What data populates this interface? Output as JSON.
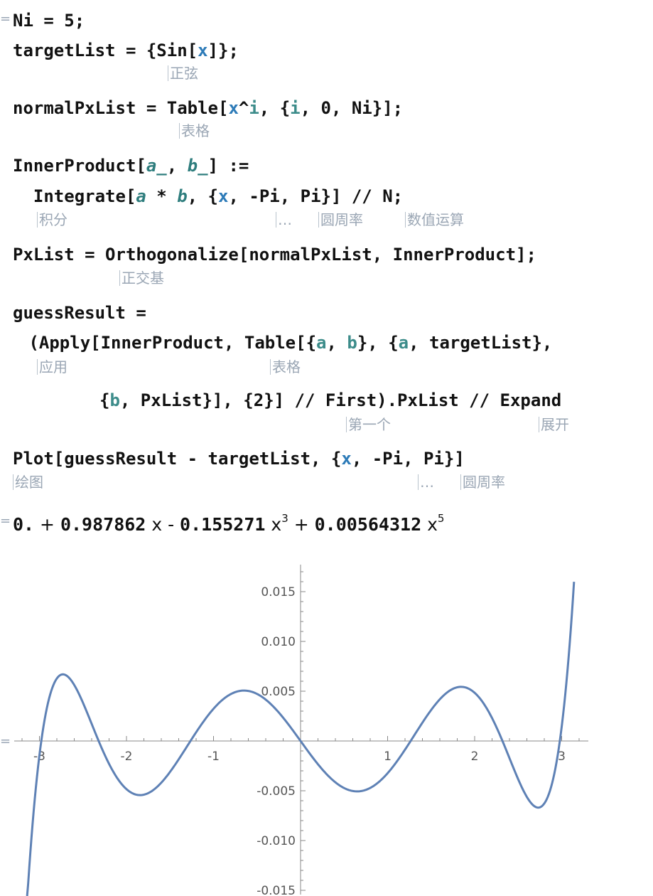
{
  "code": {
    "l1": "Ni = 5;",
    "l2a": "targetList = {Sin[",
    "l2x": "x",
    "l2b": "]};",
    "h2": "正弦",
    "l3a": "normalPxList = Table[",
    "l3x": "x",
    "l3b": "^",
    "l3i": "i",
    "l3c": ", {",
    "l3i2": "i",
    "l3d": ", 0, Ni}];",
    "h3": "表格",
    "l4a": "InnerProduct[",
    "l4p1": "a_",
    "l4b": ", ",
    "l4p2": "b_",
    "l4c": "] :=",
    "l5a": "  Integrate[",
    "l5p1": "a",
    "l5b": " * ",
    "l5p2": "b",
    "l5c": ", {",
    "l5x": "x",
    "l5d": ", -Pi, Pi}] // N;",
    "h5a": "积分",
    "h5b": "…",
    "h5c": "圆周率",
    "h5d": "数值运算",
    "l6": "PxList = Orthogonalize[normalPxList, InnerProduct];",
    "h6": "正交基",
    "l7": "guessResult =",
    "l8a": " (Apply[InnerProduct, Table[{",
    "l8v1": "a",
    "l8b": ", ",
    "l8v2": "b",
    "l8c": "}, {",
    "l8v3": "a",
    "l8d": ", targetList},",
    "h8a": "应用",
    "h8b": "表格",
    "l9a": "{",
    "l9v": "b",
    "l9b": ", PxList}], {2}] // First).PxList // Expand",
    "h9a": "第一个",
    "h9b": "展开",
    "l10a": "Plot[guessResult - targetList, {",
    "l10x": "x",
    "l10b": ", -Pi, Pi}]",
    "h10a": "绘图",
    "h10b": "…",
    "h10c": "圆周率"
  },
  "output": {
    "c0": "0.",
    "plus1": " + ",
    "c1": "0.987862",
    "x1": " x",
    "minus": " - ",
    "c3": "0.155271",
    "x3": " x",
    "e3": "3",
    "plus2": " + ",
    "c5": "0.00564312",
    "x5": " x",
    "e5": "5"
  },
  "chart_data": {
    "type": "line",
    "title": "",
    "xlabel": "",
    "ylabel": "",
    "xlim": [
      -3.3,
      3.3
    ],
    "ylim": [
      -0.0165,
      0.0175
    ],
    "x_ticks": [
      "-3",
      "-2",
      "-1",
      "1",
      "2",
      "3"
    ],
    "y_ticks": [
      "0.015",
      "0.010",
      "0.005",
      "-0.005",
      "-0.010",
      "-0.015"
    ],
    "function": "0.987862 x - 0.155271 x^3 + 0.00564312 x^5 - sin(x)",
    "coefficients": {
      "x1": 0.987862,
      "x3": -0.155271,
      "x5": 0.00564312
    },
    "domain": [
      -3.14159,
      3.14159
    ],
    "line_color": "#5e81b5"
  }
}
